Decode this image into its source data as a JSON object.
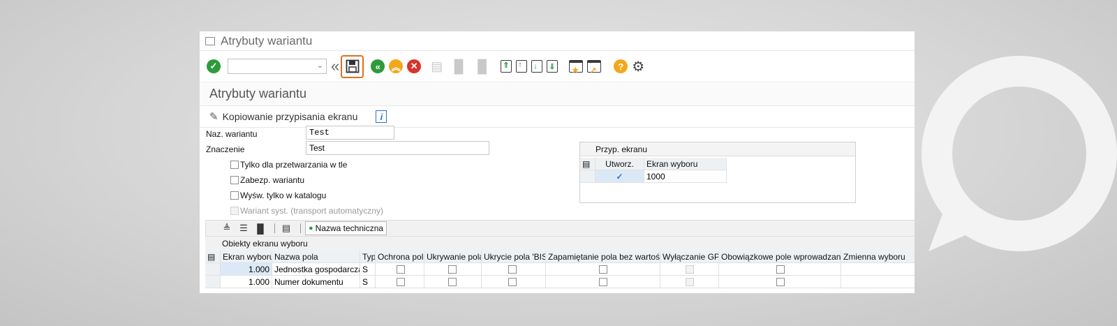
{
  "window_title": "Atrybuty wariantu",
  "toolbar": {
    "command_field": "",
    "icons": [
      "enter-icon",
      "save-icon",
      "back-icon",
      "exit-icon",
      "cancel-icon",
      "print-icon",
      "find-icon",
      "find-next-icon",
      "first-page-icon",
      "previous-page-icon",
      "next-page-icon",
      "last-page-icon",
      "create-session-icon",
      "shortcut-icon",
      "help-icon",
      "settings-icon"
    ]
  },
  "header": {
    "title": "Atrybuty wariantu"
  },
  "appbar": {
    "copy_label": "Kopiowanie przypisania ekranu",
    "info_label": "i"
  },
  "form": {
    "variant_name_label": "Naz. wariantu",
    "variant_name_value": "Test",
    "meaning_label": "Znaczenie",
    "meaning_value": "Test",
    "checkboxes": [
      {
        "label": "Tylko dla przetwarzania w tle",
        "checked": false,
        "disabled": false
      },
      {
        "label": "Zabezp. wariantu",
        "checked": false,
        "disabled": false
      },
      {
        "label": "Wyśw. tylko w katalogu",
        "checked": false,
        "disabled": false
      },
      {
        "label": "Wariant syst. (transport automatyczny)",
        "checked": false,
        "disabled": true
      }
    ]
  },
  "screen_assign": {
    "title": "Przyp. ekranu",
    "col_create": "Utworz.",
    "col_screen": "Ekran wyboru",
    "row": {
      "checked": true,
      "check_glyph": "✓",
      "screen": "1000"
    }
  },
  "grid_toolbar": {
    "tech_name_label": "Nazwa techniczna"
  },
  "objects": {
    "caption": "Obiekty ekranu wyboru",
    "columns": [
      "Ekran wyboru",
      "Nazwa pola",
      "Typ",
      "Ochrona pola",
      "Ukrywanie pola",
      "Ukrycie pola 'BIS'",
      "Zapamiętanie pola bez wartości",
      "Wyłączanie GPA",
      "Obowiązkowe pole wprowadzania",
      "Zmienna wyboru"
    ],
    "rows": [
      {
        "screen": "1.000",
        "field": "Jednostka gospodarcza",
        "type": "S"
      },
      {
        "screen": "1.000",
        "field": "Numer dokumentu",
        "type": "S"
      }
    ]
  },
  "colors": {
    "accent_orange": "#e0701a",
    "green": "#2e9b3a",
    "yellow": "#f2a81d",
    "red": "#d9342b",
    "blue": "#2b6fd1"
  }
}
